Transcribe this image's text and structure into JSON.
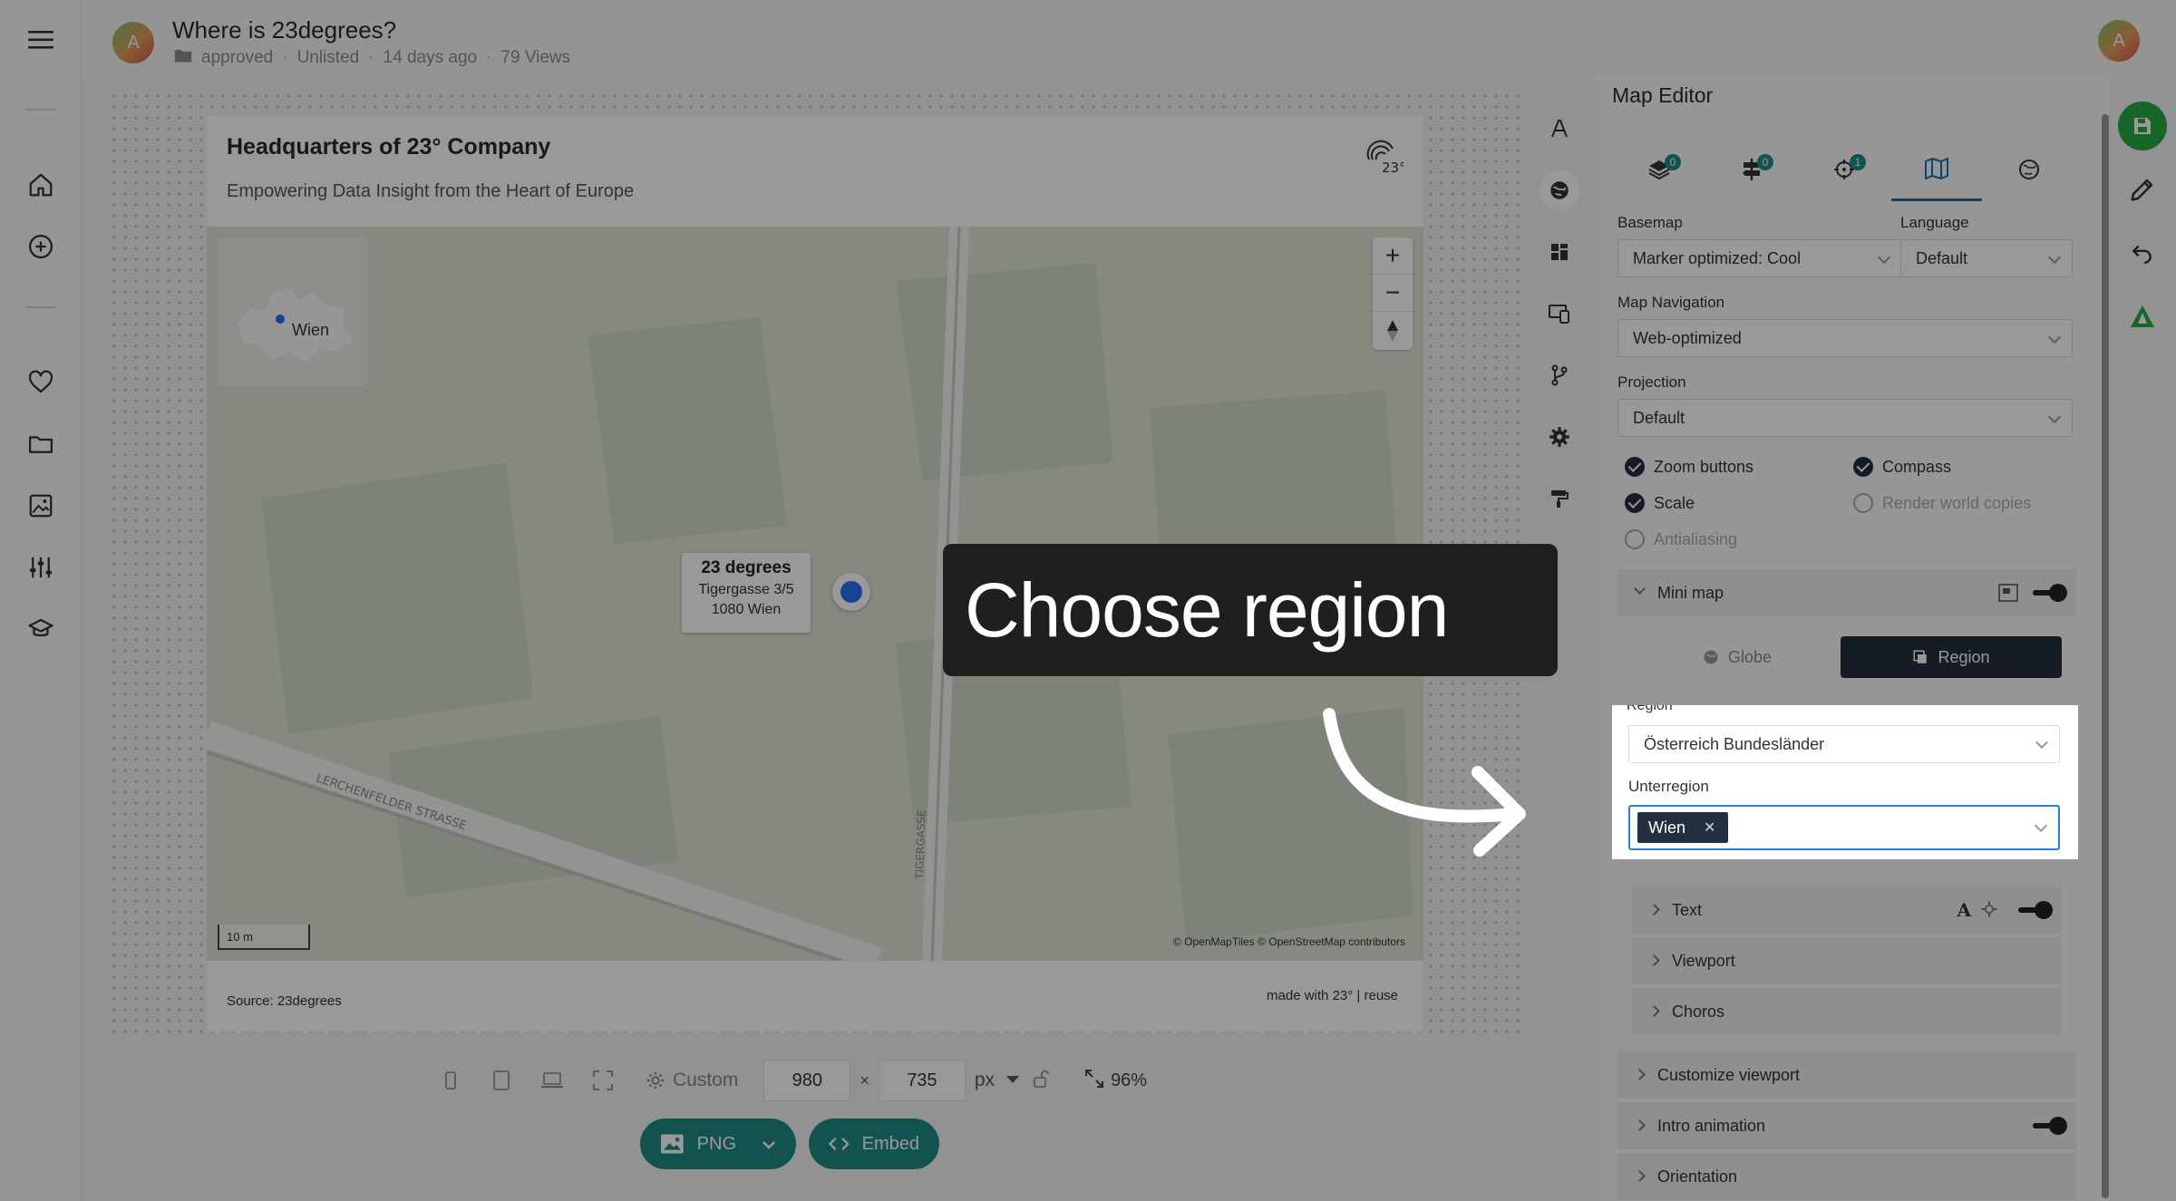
{
  "header": {
    "title": "Where is 23degrees?",
    "folder": "approved",
    "visibility": "Unlisted",
    "age": "14 days ago",
    "views": "79 Views",
    "avatar_initial": "A"
  },
  "left_sidebar": {
    "icons": [
      "menu-icon",
      "home-icon",
      "add-circle-icon",
      "heart-icon",
      "folder-icon",
      "image-icon",
      "sliders-icon",
      "graduation-icon"
    ]
  },
  "map_card": {
    "title": "Headquarters of 23° Company",
    "subtitle": "Empowering Data Insight from the Heart of Europe",
    "source": "Source: 23degrees",
    "made_with": "made with 23° | reuse",
    "logo_text": "23°",
    "minimap_label": "Wien",
    "scale_label": "10 m",
    "attribution": "© OpenMapTiles © OpenStreetMap contributors",
    "popup": {
      "name": "23 degrees",
      "street": "Tigergasse 3/5",
      "city": "1080 Wien"
    },
    "zoom_in": "+",
    "zoom_out": "−",
    "street_label_1": "LERCHENFELDER STRASSE",
    "street_label_2": "TIGERGASSE"
  },
  "size_toolbar": {
    "preset": "Custom",
    "width": "980",
    "height": "735",
    "times": "×",
    "unit": "px",
    "zoom": "96%"
  },
  "export": {
    "png_label": "PNG",
    "embed_label": "Embed"
  },
  "panel": {
    "title": "Map Editor",
    "tabs": [
      {
        "icon": "layers-icon",
        "badge": "0"
      },
      {
        "icon": "signpost-icon",
        "badge": "0"
      },
      {
        "icon": "crosshair-icon",
        "badge": "1"
      },
      {
        "icon": "map-icon",
        "badge": ""
      },
      {
        "icon": "globe-icon",
        "badge": ""
      }
    ],
    "basemap_label": "Basemap",
    "basemap_value": "Marker optimized: Cool",
    "language_label": "Language",
    "language_value": "Default",
    "navigation_label": "Map Navigation",
    "navigation_value": "Web-optimized",
    "projection_label": "Projection",
    "projection_value": "Default",
    "checks": {
      "zoom_buttons": "Zoom buttons",
      "compass": "Compass",
      "scale": "Scale",
      "render_world_copies": "Render world copies",
      "antialiasing": "Antialiasing"
    },
    "mini_map": "Mini map",
    "globe_label": "Globe",
    "region_label": "Region",
    "region_field_label": "Region",
    "region_value": "Österreich Bundesländer",
    "subregion_label": "Unterregion",
    "subregion_tag": "Wien",
    "text_section": "Text",
    "viewport_section": "Viewport",
    "choros_section": "Choros",
    "customize_viewport": "Customize viewport",
    "intro_animation": "Intro animation",
    "orientation": "Orientation"
  },
  "callout": {
    "text": "Choose region"
  },
  "colors": {
    "accent": "#1f8a86",
    "dark": "#243040",
    "focus": "#2a7fd6",
    "save_green": "#27a844"
  }
}
